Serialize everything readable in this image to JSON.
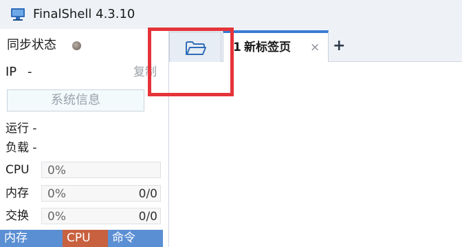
{
  "window": {
    "title": "FinalShell 4.3.10"
  },
  "sidebar": {
    "sync_status_label": "同步状态",
    "ip_label": "IP",
    "ip_value": "-",
    "copy_label": "复制",
    "sysinfo_label": "系统信息",
    "run_label": "运行 -",
    "load_label": "负载 -",
    "meters": [
      {
        "label": "CPU",
        "percent": "0%",
        "value": ""
      },
      {
        "label": "内存",
        "percent": "0%",
        "value": "0/0"
      },
      {
        "label": "交换",
        "percent": "0%",
        "value": "0/0"
      }
    ],
    "bottom_tabs": [
      "内存",
      "CPU",
      "命令"
    ]
  },
  "tabbar": {
    "tabs": [
      {
        "number": "1",
        "title": "新标签页",
        "close": "×"
      }
    ],
    "add_label": "+"
  },
  "colors": {
    "accent": "#3a7bd5",
    "highlight": "#e5333a",
    "cpu_tab": "#c8613f",
    "mem_tab": "#5b8fd4"
  }
}
